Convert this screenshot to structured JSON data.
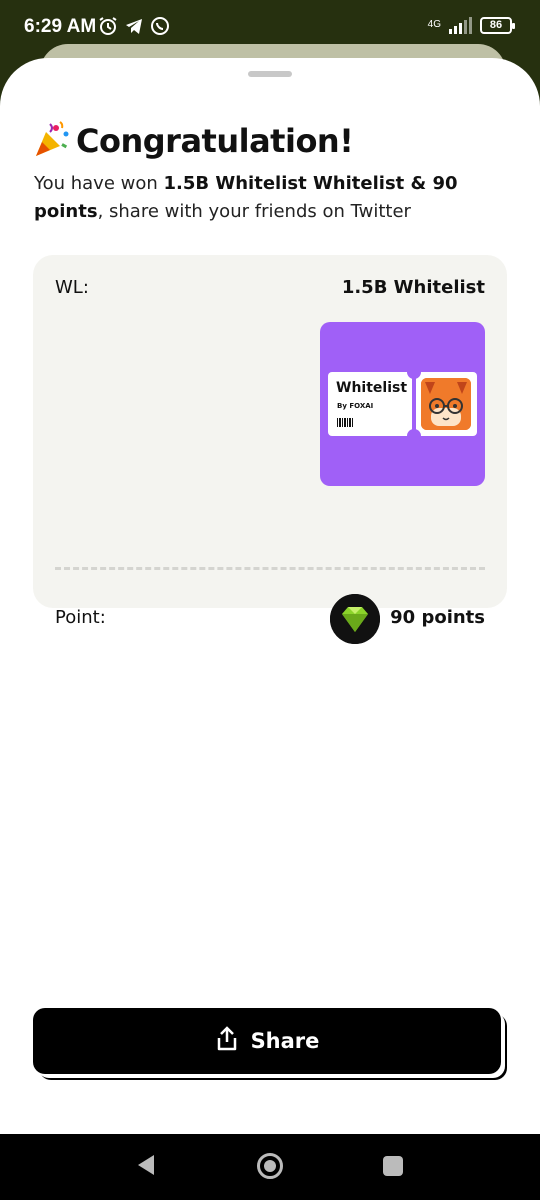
{
  "status_bar": {
    "time": "6:29 AM",
    "network": "4G",
    "battery": "86"
  },
  "dialog": {
    "title": "Congratulation!",
    "subtitle_prefix": "You have won ",
    "subtitle_bold": "1.5B Whitelist  Whitelist & 90 points",
    "subtitle_suffix": ", share with your friends on Twitter"
  },
  "card": {
    "wl_label": "WL:",
    "wl_value": "1.5B Whitelist",
    "ticket_name": "Whitelist",
    "ticket_by": "By FOXAI",
    "point_label": "Point:",
    "point_value": "90 points"
  },
  "share_button": {
    "label": "Share"
  },
  "colors": {
    "header_bg": "#26300f",
    "ticket_bg": "#a060f7",
    "card_bg": "#f4f4f0",
    "button_bg": "#000000"
  }
}
